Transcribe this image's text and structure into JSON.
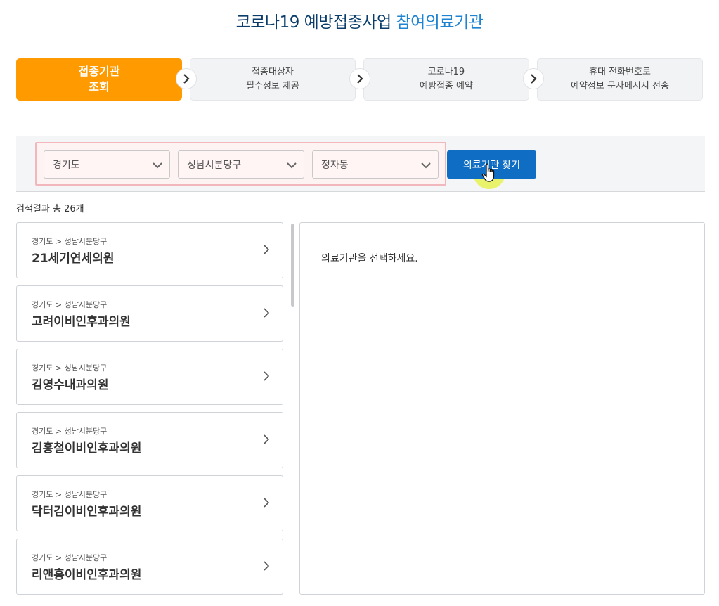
{
  "header": {
    "title_main": "코로나19 예방접종사업",
    "title_accent": "참여의료기관"
  },
  "steps": [
    {
      "line1": "접종기관",
      "line2": "조회",
      "active": true
    },
    {
      "line1": "접종대상자",
      "line2": "필수정보 제공",
      "active": false
    },
    {
      "line1": "코로나19",
      "line2": "예방접종 예약",
      "active": false
    },
    {
      "line1": "휴대 전화번호로",
      "line2": "예약정보 문자메시지 전송",
      "active": false
    }
  ],
  "search": {
    "province": "경기도",
    "district": "성남시분당구",
    "dong": "정자동",
    "find_button": "의료기관 찾기"
  },
  "results": {
    "count_label": "검색결과 총 26개",
    "items": [
      {
        "region": "경기도 > 성남시분당구",
        "name": "21세기연세의원"
      },
      {
        "region": "경기도 > 성남시분당구",
        "name": "고려이비인후과의원"
      },
      {
        "region": "경기도 > 성남시분당구",
        "name": "김영수내과의원"
      },
      {
        "region": "경기도 > 성남시분당구",
        "name": "김홍철이비인후과의원"
      },
      {
        "region": "경기도 > 성남시분당구",
        "name": "닥터김이비인후과의원"
      },
      {
        "region": "경기도 > 성남시분당구",
        "name": "리앤홍이비인후과의원"
      }
    ]
  },
  "detail": {
    "placeholder": "의료기관을 선택하세요."
  },
  "colors": {
    "active_step": "#ff9b00",
    "primary_button": "#0f6ec4",
    "title_dark": "#0a3d6b",
    "title_accent": "#1e84d2",
    "filter_highlight": "#f2b7bd"
  },
  "icons": {
    "step_arrow": "chevron-right-icon",
    "select": "chevron-down-icon",
    "card": "chevron-right-icon",
    "cursor": "hand-pointer-icon"
  }
}
